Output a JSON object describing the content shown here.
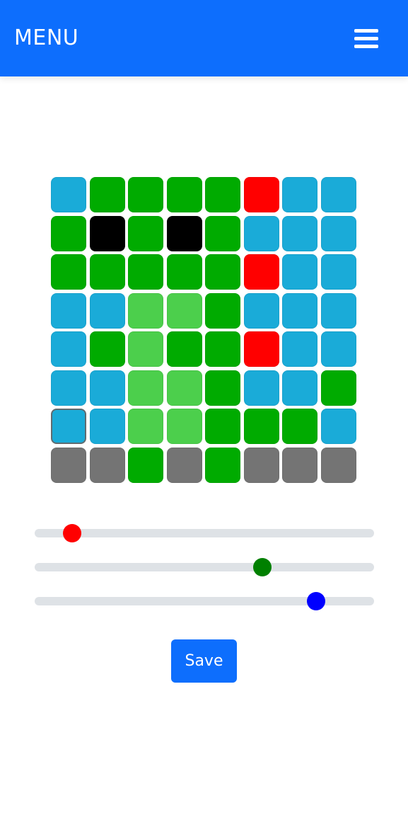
{
  "navbar": {
    "brand": "MENU",
    "menu_icon": "hamburger-icon"
  },
  "palette": {
    "blue": "#1aabd8",
    "green": "#00ab00",
    "light_green": "#4ccf4c",
    "red": "#ff0000",
    "black": "#000000",
    "gray": "#747474"
  },
  "grid": {
    "rows": [
      [
        "blue",
        "green",
        "green",
        "green",
        "green",
        "red",
        "blue",
        "blue"
      ],
      [
        "green",
        "black",
        "green",
        "black",
        "green",
        "blue",
        "blue",
        "blue"
      ],
      [
        "green",
        "green",
        "green",
        "green",
        "green",
        "red",
        "blue",
        "blue"
      ],
      [
        "blue",
        "blue",
        "light_green",
        "light_green",
        "green",
        "blue",
        "blue",
        "blue"
      ],
      [
        "blue",
        "green",
        "light_green",
        "green",
        "green",
        "red",
        "blue",
        "blue"
      ],
      [
        "blue",
        "blue",
        "light_green",
        "light_green",
        "green",
        "blue",
        "blue",
        "green"
      ],
      [
        "blue",
        "blue",
        "light_green",
        "light_green",
        "green",
        "green",
        "green",
        "blue"
      ],
      [
        "gray",
        "gray",
        "green",
        "gray",
        "green",
        "gray",
        "gray",
        "gray"
      ]
    ],
    "selected": {
      "row": 6,
      "col": 0
    }
  },
  "sliders": [
    {
      "name": "red",
      "thumb_color": "#ff0000",
      "value": 0.11
    },
    {
      "name": "green",
      "thumb_color": "#008000",
      "value": 0.67
    },
    {
      "name": "blue",
      "thumb_color": "#0000ff",
      "value": 0.83
    }
  ],
  "save_label": "Save"
}
